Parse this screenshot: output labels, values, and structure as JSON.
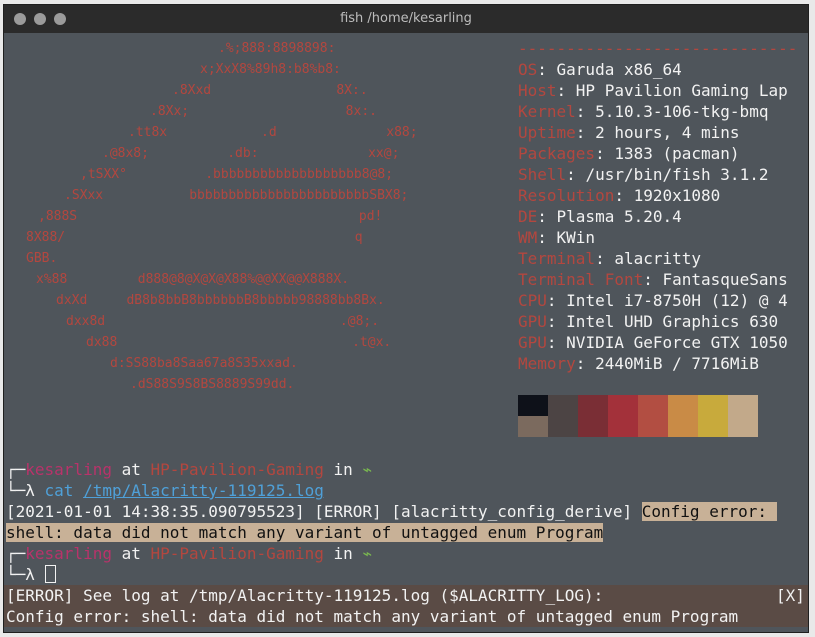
{
  "window": {
    "title": "fish /home/kesarling"
  },
  "neofetch": {
    "logo": [
      ".%;888:8898898:",
      "x;XxX8%89h8:b8%b8:",
      ".8Xxd                8X:.",
      ".8Xx;                    8x:.",
      ".tt8x            .d              x88;",
      ".@8x8;          .db:              xx@;",
      ",tSXX°          .bbbbbbbbbbbbbbbbbbb8@8;",
      ".SXxx           bbbbbbbbbbbbbbbbbbbbbbbSBX8;",
      ",888S                                    pd!",
      "8X88/                                     q",
      "GBB.",
      "x%88         d888@8@X@X@X88%@@XX@@X888X.",
      "dxXd     dB8b8bbB8bbbbbbB8bbbbb98888bb8Bx.",
      "dxx8d                              .@8;.",
      "dx88                              .t@x.",
      "d:SS88ba8Saa67a8S35xxad.",
      ".dS88S9S8BS8889S99dd."
    ],
    "separator": "-----------------------------",
    "info": [
      {
        "key": "OS",
        "value": "Garuda x86_64"
      },
      {
        "key": "Host",
        "value": "HP Pavilion Gaming Lap"
      },
      {
        "key": "Kernel",
        "value": "5.10.3-106-tkg-bmq"
      },
      {
        "key": "Uptime",
        "value": "2 hours, 4 mins"
      },
      {
        "key": "Packages",
        "value": "1383 (pacman)"
      },
      {
        "key": "Shell",
        "value": "/usr/bin/fish 3.1.2"
      },
      {
        "key": "Resolution",
        "value": "1920x1080"
      },
      {
        "key": "DE",
        "value": "Plasma 5.20.4"
      },
      {
        "key": "WM",
        "value": "KWin"
      },
      {
        "key": "Terminal",
        "value": "alacritty"
      },
      {
        "key": "Terminal Font",
        "value": "FantasqueSans"
      },
      {
        "key": "CPU",
        "value": "Intel i7-8750H (12) @ 4"
      },
      {
        "key": "GPU",
        "value": "Intel UHD Graphics 630"
      },
      {
        "key": "GPU",
        "value": "NVIDIA GeForce GTX 1050"
      },
      {
        "key": "Memory",
        "value": "2440MiB / 7716MiB"
      }
    ],
    "palette_top": [
      "#0e1119",
      "#4c4444",
      "#7a2e35",
      "#a3313a",
      "#b24e42",
      "#c98b46",
      "#c8aa3c",
      "#c2a98a"
    ],
    "palette_bottom": [
      "#7b6a5e"
    ]
  },
  "prompt1": {
    "corner": "┌─",
    "user": "kesarling",
    "at": " at ",
    "host": "HP-Pavilion-Gaming",
    "in": " in ",
    "dir": "⌁"
  },
  "cmd1": {
    "corner": "└─λ ",
    "command": "cat ",
    "arg": "/tmp/Alacritty-119125.log"
  },
  "log": {
    "line1_prefix": "[2021-01-01 14:38:35.090795523] [ERROR] [alacritty_config_derive] ",
    "line1_hl": "Config error: ",
    "line2_hl": "shell: data did not match any variant of untagged enum Program"
  },
  "prompt2": {
    "corner": "┌─",
    "user": "kesarling",
    "at": " at ",
    "host": "HP-Pavilion-Gaming",
    "in": " in ",
    "dir": "⌁"
  },
  "cmd2": {
    "corner": "└─λ "
  },
  "status": {
    "line1": "[ERROR] See log at /tmp/Alacritty-119125.log ($ALACRITTY_LOG):",
    "close": "[X]",
    "line2": "Config error: shell: data did not match any variant of untagged enum Program"
  },
  "colors": {
    "bg": "#4f555b",
    "accent": "#b3473f",
    "user": "#b8336a",
    "host": "#b3473f",
    "link": "#4fa0d8",
    "highlight": "#c8b197"
  }
}
